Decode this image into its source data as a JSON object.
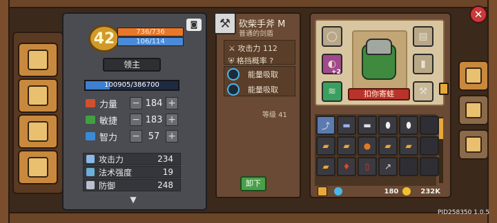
{
  "header": {
    "close_label": "✕"
  },
  "left_nav": {
    "items": [
      {
        "name": "book-icon"
      },
      {
        "name": "map-icon"
      },
      {
        "name": "pet-icon"
      },
      {
        "name": "vehicle-icon"
      }
    ]
  },
  "character": {
    "level": "42",
    "hp": "736/736",
    "mp": "106/114",
    "title": "领主",
    "exp": "100905/386700",
    "exp_fraction": 0.26,
    "stats": [
      {
        "name": "力量",
        "value": "184",
        "color": "#d05030"
      },
      {
        "name": "敏捷",
        "value": "183",
        "color": "#40a040"
      },
      {
        "name": "智力",
        "value": "57",
        "color": "#3a8ad8"
      }
    ],
    "derived": [
      {
        "name": "攻击力",
        "value": "234"
      },
      {
        "name": "法术强度",
        "value": "19"
      },
      {
        "name": "防御",
        "value": "248"
      }
    ]
  },
  "item": {
    "name": "砍柴手斧 M",
    "type": "普通的剑盾",
    "attrs": [
      {
        "label": "攻击力 112"
      },
      {
        "label": "格挡概率 ?"
      }
    ],
    "skills": [
      {
        "name": "能量吸取"
      },
      {
        "name": "能量吸取"
      }
    ],
    "level": "等级 41",
    "unequip_label": "卸下"
  },
  "equipment": {
    "hero_name": "扣你寄蛙",
    "slot_badge": "+2"
  },
  "inventory": {
    "gems": "180",
    "gold": "232K"
  },
  "footer": {
    "pid": "PID258350 1.0.5"
  },
  "colors": {
    "accent": "#e8a838",
    "hp": "#e8772a",
    "mp": "#4a8ad8",
    "hero_tag": "#b8342a",
    "unequip": "#4aa04a"
  }
}
